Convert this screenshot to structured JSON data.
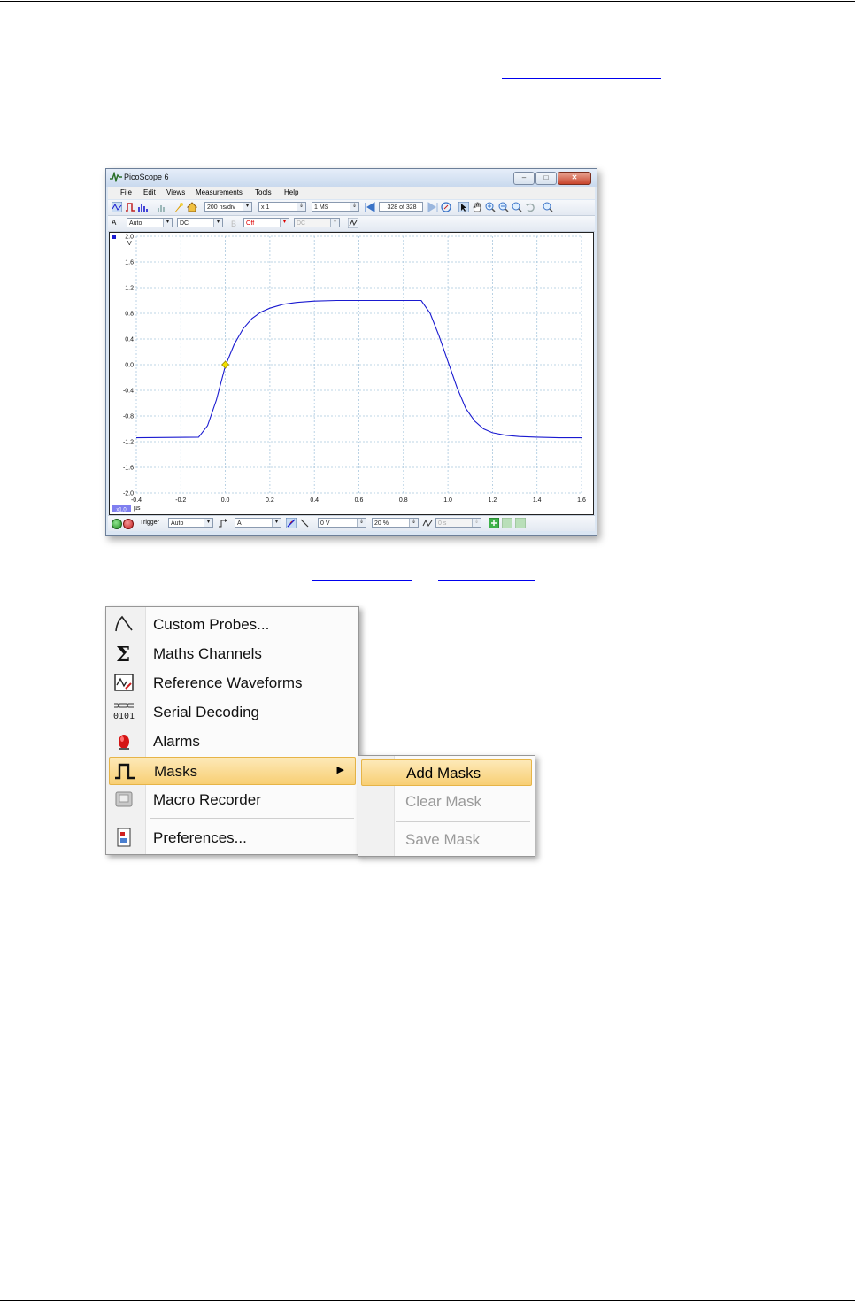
{
  "window": {
    "title": "PicoScope 6",
    "menu": [
      "File",
      "Edit",
      "Views",
      "Measurements",
      "Tools",
      "Help"
    ],
    "toolbar": {
      "timebase": "200 ns/div",
      "zoom": "x 1",
      "samples": "1 MS",
      "buffer_current": "328",
      "buffer_of": "of 328"
    },
    "channel": {
      "label": "A",
      "range": "Auto",
      "coupling": "DC",
      "ch_b_state": "Off",
      "ch_b_coupling": "DC"
    },
    "bottom": {
      "trigger_label": "Trigger",
      "trigger_mode": "Auto",
      "trigger_channel": "A",
      "threshold": "0 V",
      "pre_trigger": "20 %",
      "delay": "0 s"
    },
    "colors": {
      "trace": "#1a1ad0",
      "grid": "#a9c7de",
      "trigger_marker": "#f2e000"
    }
  },
  "chart_data": {
    "type": "line",
    "ylabel": "V",
    "xlabel": "µs",
    "xlim": [
      -0.4,
      1.6
    ],
    "ylim": [
      -2.0,
      2.0
    ],
    "x_ticks": [
      -0.4,
      -0.2,
      0.0,
      0.2,
      0.4,
      0.6,
      0.8,
      1.0,
      1.2,
      1.4,
      1.6
    ],
    "y_ticks": [
      -2.0,
      -1.6,
      -1.2,
      -0.8,
      -0.4,
      0.0,
      0.4,
      0.8,
      1.2,
      1.6,
      2.0
    ],
    "x_tick_labels": [
      "-0.4",
      "-0.2",
      "0.0",
      "0.2",
      "0.4",
      "0.6",
      "0.8",
      "1.0",
      "1.2",
      "1.4",
      "1.6"
    ],
    "y_tick_labels": [
      "-2.0",
      "-1.6",
      "-1.2",
      "-0.8",
      "-0.4",
      "0.0",
      "0.4",
      "0.8",
      "1.2",
      "1.6",
      "2.0"
    ],
    "zoom_badge": "x1.0",
    "grid": true,
    "series": [
      {
        "x": [
          -0.4,
          -0.12,
          -0.08,
          -0.04,
          0.0,
          0.04,
          0.08,
          0.12,
          0.16,
          0.2,
          0.26,
          0.32,
          0.4,
          0.5,
          0.6,
          0.7,
          0.8,
          0.88,
          0.92,
          0.96,
          1.0,
          1.04,
          1.08,
          1.12,
          1.16,
          1.2,
          1.26,
          1.32,
          1.4,
          1.5,
          1.6
        ],
        "y": [
          -1.14,
          -1.13,
          -0.95,
          -0.55,
          -0.02,
          0.32,
          0.56,
          0.72,
          0.82,
          0.88,
          0.94,
          0.97,
          0.99,
          1.0,
          1.0,
          1.0,
          1.0,
          1.0,
          0.8,
          0.45,
          0.05,
          -0.35,
          -0.68,
          -0.88,
          -1.0,
          -1.06,
          -1.1,
          -1.12,
          -1.13,
          -1.14,
          -1.14
        ]
      }
    ],
    "trigger_point": {
      "x": 0.0,
      "y": 0.0
    }
  },
  "context_menu": {
    "items": [
      {
        "label": "Custom Probes...",
        "icon": "probe-icon"
      },
      {
        "label": "Maths Channels",
        "icon": "sigma-icon"
      },
      {
        "label": "Reference Waveforms",
        "icon": "reference-waveform-icon"
      },
      {
        "label": "Serial Decoding",
        "icon": "serial-decoding-icon"
      },
      {
        "label": "Alarms",
        "icon": "alarm-icon"
      },
      {
        "label": "Masks",
        "icon": "mask-pulse-icon"
      },
      {
        "label": "Macro Recorder",
        "icon": "macro-recorder-icon"
      },
      {
        "label": "Preferences...",
        "icon": "preferences-icon"
      }
    ],
    "submenu": [
      {
        "label": "Add Masks",
        "enabled": true
      },
      {
        "label": "Clear Mask",
        "enabled": false
      },
      {
        "label": "Save Mask",
        "enabled": false
      }
    ],
    "highlight": "#f8cf74"
  }
}
